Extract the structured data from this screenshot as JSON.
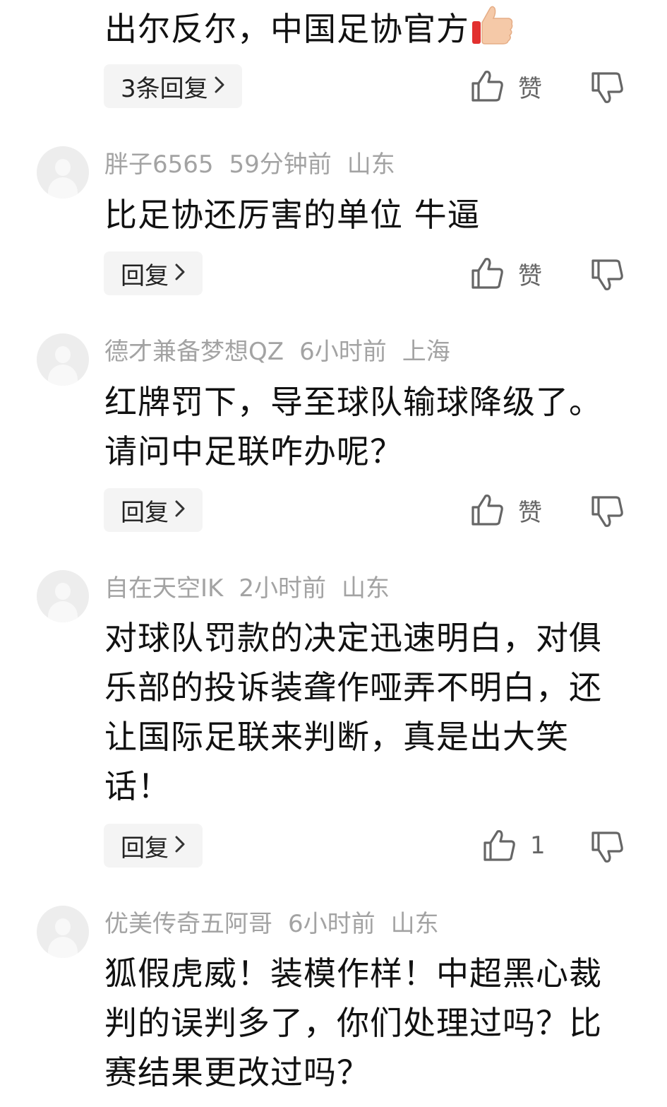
{
  "comments": [
    {
      "user": "",
      "time": "",
      "location": "",
      "text": "出尔反尔，中国足协官方",
      "reply_label": "3条回复",
      "like_label": "赞"
    },
    {
      "user": "胖子6565",
      "time": "59分钟前",
      "location": "山东",
      "text": "比足协还厉害的单位 牛逼",
      "reply_label": "回复",
      "like_label": "赞"
    },
    {
      "user": "德才兼备梦想QZ",
      "time": "6小时前",
      "location": "上海",
      "text": "红牌罚下，导至球队输球降级了。请问中足联咋办呢？",
      "reply_label": "回复",
      "like_label": "赞"
    },
    {
      "user": "自在天空IK",
      "time": "2小时前",
      "location": "山东",
      "text": "对球队罚款的决定迅速明白，对俱乐部的投诉装聋作哑弄不明白，还让国际足联来判断，真是出大笑话！",
      "reply_label": "回复",
      "like_label": "1"
    },
    {
      "user": "优美传奇五阿哥",
      "time": "6小时前",
      "location": "山东",
      "text": "狐假虎威！装模作样！中超黑心裁判的误判多了，你们处理过吗？比赛结果更改过吗？",
      "reply_label": "",
      "like_label": ""
    }
  ],
  "icons": {
    "like": "thumbs-up-outline-icon",
    "dislike": "thumbs-down-outline-icon",
    "chevron": "chevron-right-icon",
    "emoji": "thumbs-up-emoji-icon",
    "avatar": "default-avatar-icon"
  },
  "colors": {
    "text": "#111111",
    "meta": "#a3a3a3",
    "button_bg": "#f4f4f4",
    "icon": "#666666"
  }
}
